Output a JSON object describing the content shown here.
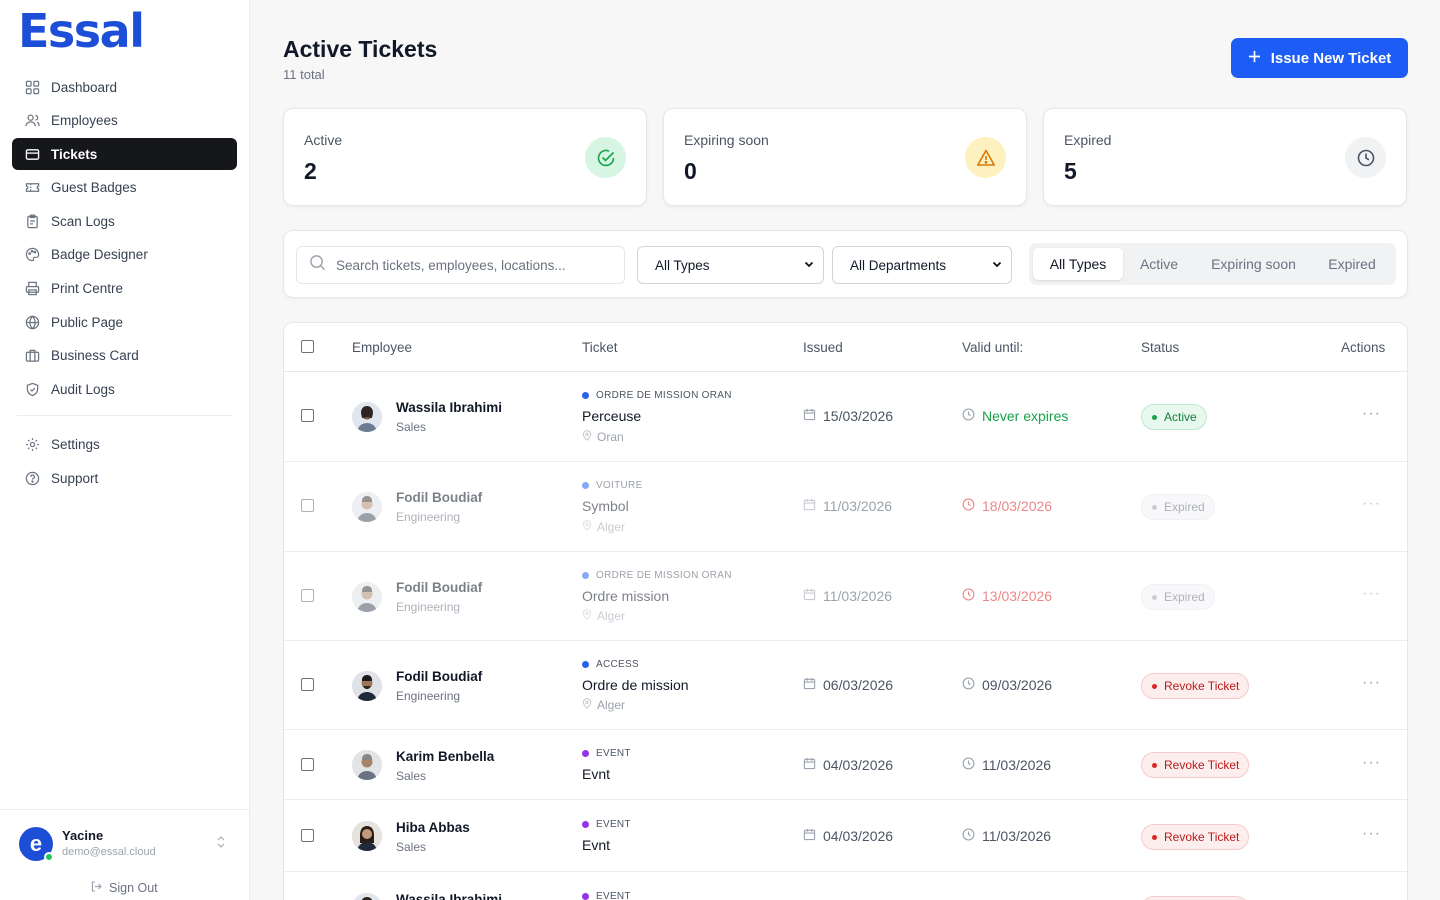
{
  "brand": {
    "logo_text": "Essal",
    "accent": "#1d5cf5"
  },
  "sidebar": {
    "items": [
      {
        "label": "Dashboard",
        "icon": "grid-icon"
      },
      {
        "label": "Employees",
        "icon": "users-icon"
      },
      {
        "label": "Tickets",
        "icon": "ticket-icon",
        "active": true
      },
      {
        "label": "Guest Badges",
        "icon": "badge-icon"
      },
      {
        "label": "Scan Logs",
        "icon": "clipboard-icon"
      },
      {
        "label": "Badge Designer",
        "icon": "palette-icon"
      },
      {
        "label": "Print Centre",
        "icon": "printer-icon"
      },
      {
        "label": "Public Page",
        "icon": "globe-icon"
      },
      {
        "label": "Business Card",
        "icon": "briefcase-icon"
      },
      {
        "label": "Audit Logs",
        "icon": "shield-icon"
      }
    ],
    "secondary": [
      {
        "label": "Settings",
        "icon": "gear-icon"
      },
      {
        "label": "Support",
        "icon": "help-icon"
      }
    ],
    "user": {
      "name": "Yacine",
      "email": "demo@essal.cloud",
      "initial": "e"
    },
    "signout_label": "Sign Out"
  },
  "header": {
    "title": "Active Tickets",
    "subtitle": "11 total",
    "new_button_label": "Issue New Ticket"
  },
  "stats": [
    {
      "label": "Active",
      "value": "2",
      "icon": "check-circle-icon",
      "color": "#16a34a"
    },
    {
      "label": "Expiring soon",
      "value": "0",
      "icon": "warning-icon",
      "color": "#d97706"
    },
    {
      "label": "Expired",
      "value": "5",
      "icon": "clock-icon",
      "color": "#4b5563"
    }
  ],
  "filters": {
    "search_placeholder": "Search tickets, employees, locations...",
    "type_select": "All Types",
    "dept_select": "All Departments",
    "segments": [
      "All Types",
      "Active",
      "Expiring soon",
      "Expired"
    ],
    "active_segment": "All Types"
  },
  "table": {
    "columns": [
      "Employee",
      "Ticket",
      "Issued",
      "Valid until:",
      "Status",
      "Actions"
    ],
    "rows": [
      {
        "name": "Wassila Ibrahimi",
        "dept": "Sales",
        "type": "ORDRE DE MISSION ORAN",
        "type_color": "#2563eb",
        "ticket": "Perceuse",
        "location": "Oran",
        "issued": "15/03/2026",
        "valid": "Never expires",
        "valid_style": "green",
        "status": "Active",
        "status_kind": "active",
        "faded": false
      },
      {
        "name": "Fodil Boudiaf",
        "dept": "Engineering",
        "type": "VOITURE",
        "type_color": "#2563eb",
        "ticket": "Symbol",
        "location": "Alger",
        "issued": "11/03/2026",
        "valid": "18/03/2026",
        "valid_style": "red",
        "status": "Expired",
        "status_kind": "expired",
        "faded": true
      },
      {
        "name": "Fodil Boudiaf",
        "dept": "Engineering",
        "type": "ORDRE DE MISSION ORAN",
        "type_color": "#2563eb",
        "ticket": "Ordre mission",
        "location": "Alger",
        "issued": "11/03/2026",
        "valid": "13/03/2026",
        "valid_style": "red",
        "status": "Expired",
        "status_kind": "expired",
        "faded": true
      },
      {
        "name": "Fodil Boudiaf",
        "dept": "Engineering",
        "type": "ACCESS",
        "type_color": "#2563eb",
        "ticket": "Ordre de mission",
        "location": "Alger",
        "issued": "06/03/2026",
        "valid": "09/03/2026",
        "valid_style": "normal",
        "status": "Revoke Ticket",
        "status_kind": "revoke",
        "faded": false
      },
      {
        "name": "Karim Benbella",
        "dept": "Sales",
        "type": "EVENT",
        "type_color": "#9333ea",
        "ticket": "Evnt",
        "location": "",
        "issued": "04/03/2026",
        "valid": "11/03/2026",
        "valid_style": "normal",
        "status": "Revoke Ticket",
        "status_kind": "revoke",
        "faded": false
      },
      {
        "name": "Hiba Abbas",
        "dept": "Sales",
        "type": "EVENT",
        "type_color": "#9333ea",
        "ticket": "Evnt",
        "location": "",
        "issued": "04/03/2026",
        "valid": "11/03/2026",
        "valid_style": "normal",
        "status": "Revoke Ticket",
        "status_kind": "revoke",
        "faded": false
      },
      {
        "name": "Wassila Ibrahimi",
        "dept": "",
        "type": "EVENT",
        "type_color": "#9333ea",
        "ticket": "",
        "location": "",
        "issued": "",
        "valid": "",
        "valid_style": "normal",
        "status": "",
        "status_kind": "revoke",
        "faded": false
      }
    ]
  }
}
